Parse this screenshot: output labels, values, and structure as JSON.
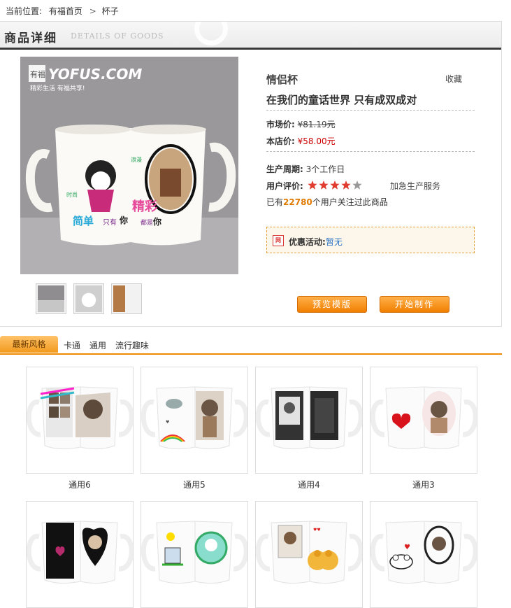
{
  "breadcrumb": {
    "prefix": "当前位置:",
    "home": "有福首页",
    "sep": ">",
    "current": "杯子"
  },
  "detail_header": {
    "title": "商品详细",
    "subtitle": "DETAILS OF GOODS"
  },
  "main_image": {
    "logo": "YOFUS.COM",
    "logo_mark": "有福",
    "tagline": "精彩生活 有福共享!",
    "mug_words": [
      "简单",
      "只有",
      "你",
      "精彩",
      "都是",
      "你",
      "时尚",
      "浪漫"
    ]
  },
  "product": {
    "name": "情侣杯",
    "favorite": "收藏",
    "slogan": "在我们的童话世界 只有成双成对",
    "market_price_label": "市场价:",
    "market_price": "¥81.19元",
    "store_price_label": "本店价:",
    "store_price": "¥58.00元",
    "production_label": "生产周期:",
    "production_value": "3个工作日",
    "rating_label": "用户评价:",
    "rating": 4,
    "rating_max": 5,
    "addon_service": "加急生产服务",
    "followers_prefix": "已有",
    "followers_count": "22780",
    "followers_suffix": "个用户关注过此商品"
  },
  "promo": {
    "icon": "网",
    "label": "优惠活动:",
    "value": "暂无"
  },
  "buttons": {
    "preview": "预览模版",
    "start": "开始制作"
  },
  "tabs": {
    "active": "最新风格",
    "items": [
      "卡通",
      "通用",
      "流行趣味"
    ]
  },
  "grid": [
    {
      "caption": "通用6",
      "art": "collage"
    },
    {
      "caption": "通用5",
      "art": "cloud"
    },
    {
      "caption": "通用4",
      "art": "frames"
    },
    {
      "caption": "通用3",
      "art": "hearts"
    },
    {
      "caption": "",
      "art": "black-heart"
    },
    {
      "caption": "",
      "art": "sketch"
    },
    {
      "caption": "",
      "art": "bears"
    },
    {
      "caption": "",
      "art": "doodle"
    }
  ],
  "colors": {
    "accent": "#f08a00",
    "price_red": "#cc0000",
    "link_blue": "#2a73c7",
    "star": "#e03b2f"
  }
}
